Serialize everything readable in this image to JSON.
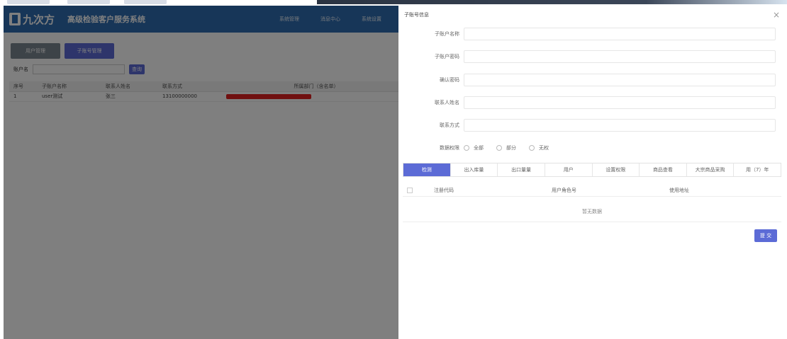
{
  "app": {
    "logo_text": "九次方",
    "system_title": "高级检验客户服务系统",
    "nav": [
      "系统管理",
      "消息中心",
      "系统设置"
    ],
    "tabs": [
      "用户管理",
      "子账号管理"
    ],
    "search": {
      "label": "账户名",
      "button": "查询"
    },
    "table": {
      "headers": [
        "序号",
        "子账户名称",
        "联系人姓名",
        "联系方式",
        "所属部门（含名单）"
      ],
      "rows": [
        {
          "index": "1",
          "name": "user测试",
          "contact": "张三",
          "phone": "13100000000"
        }
      ]
    }
  },
  "panel": {
    "title": "子账号信息",
    "close": "×",
    "fields": [
      {
        "label": "子账户名称"
      },
      {
        "label": "子账户密码"
      },
      {
        "label": "确认密码"
      },
      {
        "label": "联系人姓名"
      },
      {
        "label": "联系方式"
      }
    ],
    "radio": {
      "label": "数据权限",
      "options": [
        "全部",
        "部分",
        "无权"
      ]
    },
    "segments": [
      "检测",
      "出入库量",
      "出口量量",
      "用户",
      "设置权限",
      "商品查看",
      "大宗商品采购",
      "用（7）年"
    ],
    "sub_table": {
      "headers": [
        "注册代码",
        "用户角色号",
        "使用地址"
      ],
      "empty": "暂无数据"
    },
    "submit": "提 交"
  }
}
